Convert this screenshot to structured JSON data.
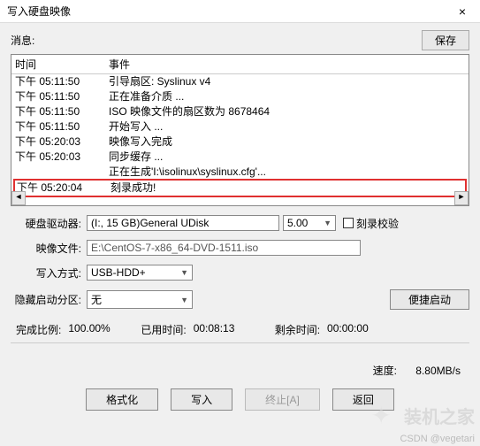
{
  "window": {
    "title": "写入硬盘映像",
    "close": "×"
  },
  "msg": {
    "label": "消息:",
    "save": "保存"
  },
  "log": {
    "head_time": "时间",
    "head_event": "事件",
    "rows": [
      {
        "time": "下午 05:11:50",
        "event": "引导扇区: Syslinux v4"
      },
      {
        "time": "下午 05:11:50",
        "event": "正在准备介质 ..."
      },
      {
        "time": "下午 05:11:50",
        "event": "ISO 映像文件的扇区数为 8678464"
      },
      {
        "time": "下午 05:11:50",
        "event": "开始写入 ..."
      },
      {
        "time": "下午 05:20:03",
        "event": "映像写入完成"
      },
      {
        "time": "下午 05:20:03",
        "event": "同步缓存 ..."
      },
      {
        "time": "",
        "event": "正在生成'I:\\isolinux\\syslinux.cfg'..."
      },
      {
        "time": "下午 05:20:04",
        "event": "刻录成功!"
      }
    ],
    "highlight_index": 7
  },
  "fields": {
    "drive_label": "硬盘驱动器:",
    "drive_value": "(I:, 15 GB)General UDisk",
    "drive_speed": "5.00",
    "verify_label": "刻录校验",
    "image_label": "映像文件:",
    "image_value": "E:\\CentOS-7-x86_64-DVD-1511.iso",
    "write_label": "写入方式:",
    "write_value": "USB-HDD+",
    "hidden_label": "隐藏启动分区:",
    "hidden_value": "无",
    "portable_btn": "便捷启动"
  },
  "stats": {
    "done_label": "完成比例:",
    "done_value": "100.00%",
    "elapsed_label": "已用时间:",
    "elapsed_value": "00:08:13",
    "remain_label": "剩余时间:",
    "remain_value": "00:00:00",
    "speed_label": "速度:",
    "speed_value": "8.80MB/s"
  },
  "buttons": {
    "format": "格式化",
    "write": "写入",
    "abort": "终止[A]",
    "back": "返回"
  },
  "watermark": "装机之家",
  "csdn": "CSDN @vegetari"
}
